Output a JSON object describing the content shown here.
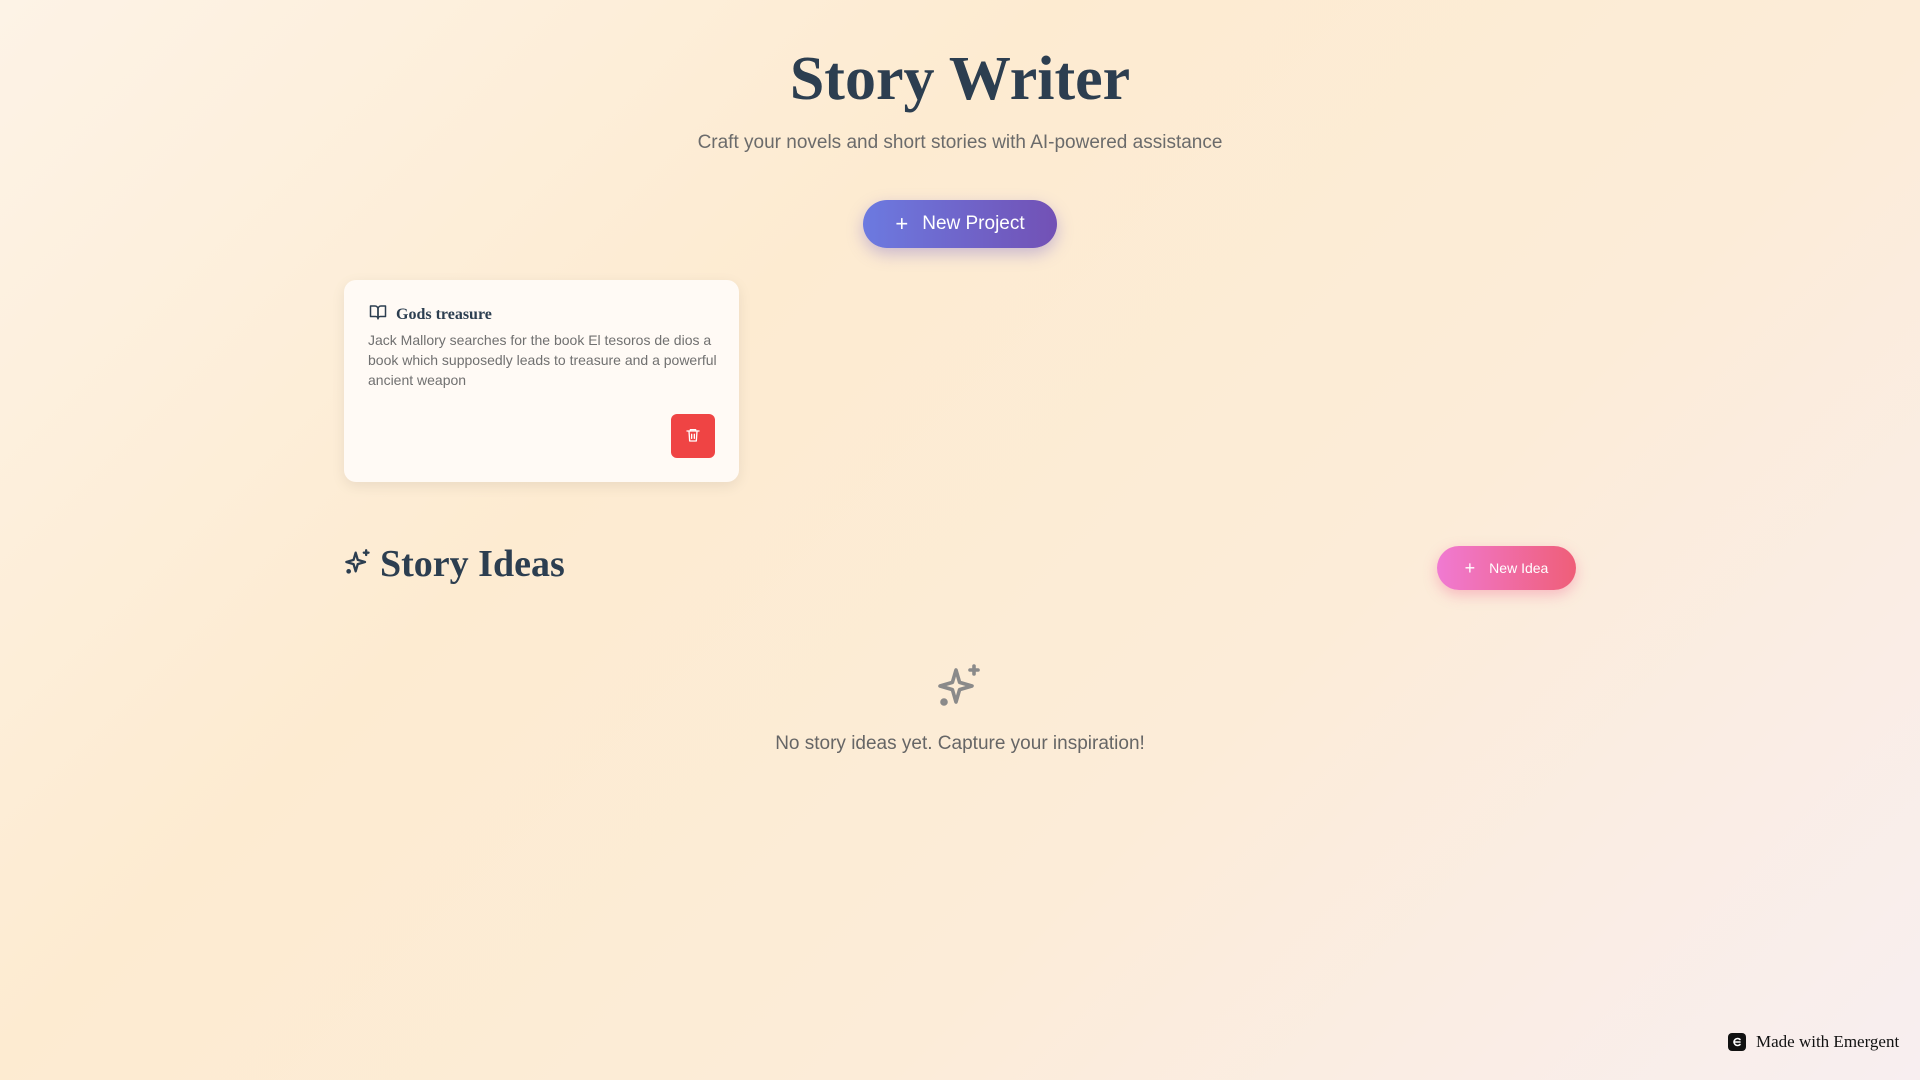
{
  "header": {
    "title": "Story Writer",
    "subtitle": "Craft your novels and short stories with AI-powered assistance"
  },
  "actions": {
    "new_project_label": "New Project",
    "new_idea_label": "New Idea"
  },
  "projects": [
    {
      "title": "Gods treasure",
      "description": "Jack Mallory searches for the book El tesoros de dios a book which supposedly leads to treasure and a powerful ancient weapon",
      "icon": "book-open-icon"
    }
  ],
  "ideas": {
    "heading": "Story Ideas",
    "empty_message": "No story ideas yet. Capture your inspiration!",
    "icon": "sparkles-icon"
  },
  "footer": {
    "badge_label": "Made with Emergent"
  },
  "colors": {
    "title": "#2c3e50",
    "new_project_gradient": [
      "#6c7ae0",
      "#7251b5"
    ],
    "new_idea_gradient": [
      "#f07ad2",
      "#ef5e78"
    ],
    "delete": "#ef4444"
  }
}
